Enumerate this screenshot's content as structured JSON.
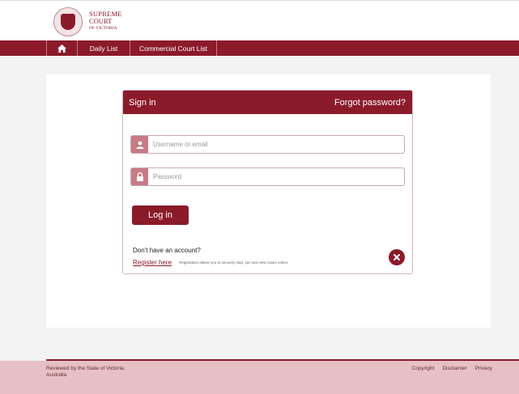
{
  "header": {
    "brand_line1": "SUPREME",
    "brand_line2": "COURT",
    "brand_line3": "OF VICTORIA"
  },
  "nav": {
    "home_icon": "home-icon",
    "daily_list": "Daily List",
    "commercial_court_list": "Commercial Court List"
  },
  "signin": {
    "title": "Sign in",
    "forgot_password": "Forgot password?",
    "username_placeholder": "Username or email",
    "password_placeholder": "Password",
    "login_label": "Log in",
    "no_account": "Don't have an account?",
    "register_label": "Register here",
    "register_info": "Registration allows you to securely  start, join and view cases online."
  },
  "footer": {
    "reviewed": "Reviewed by the State of Victoria, Australia",
    "links": [
      "Copyright",
      "Disclaimer",
      "Privacy"
    ]
  },
  "colors": {
    "brand": "#8b1a2b",
    "icon_bg": "#c67b87",
    "footer_bg": "#e6c0c5"
  }
}
